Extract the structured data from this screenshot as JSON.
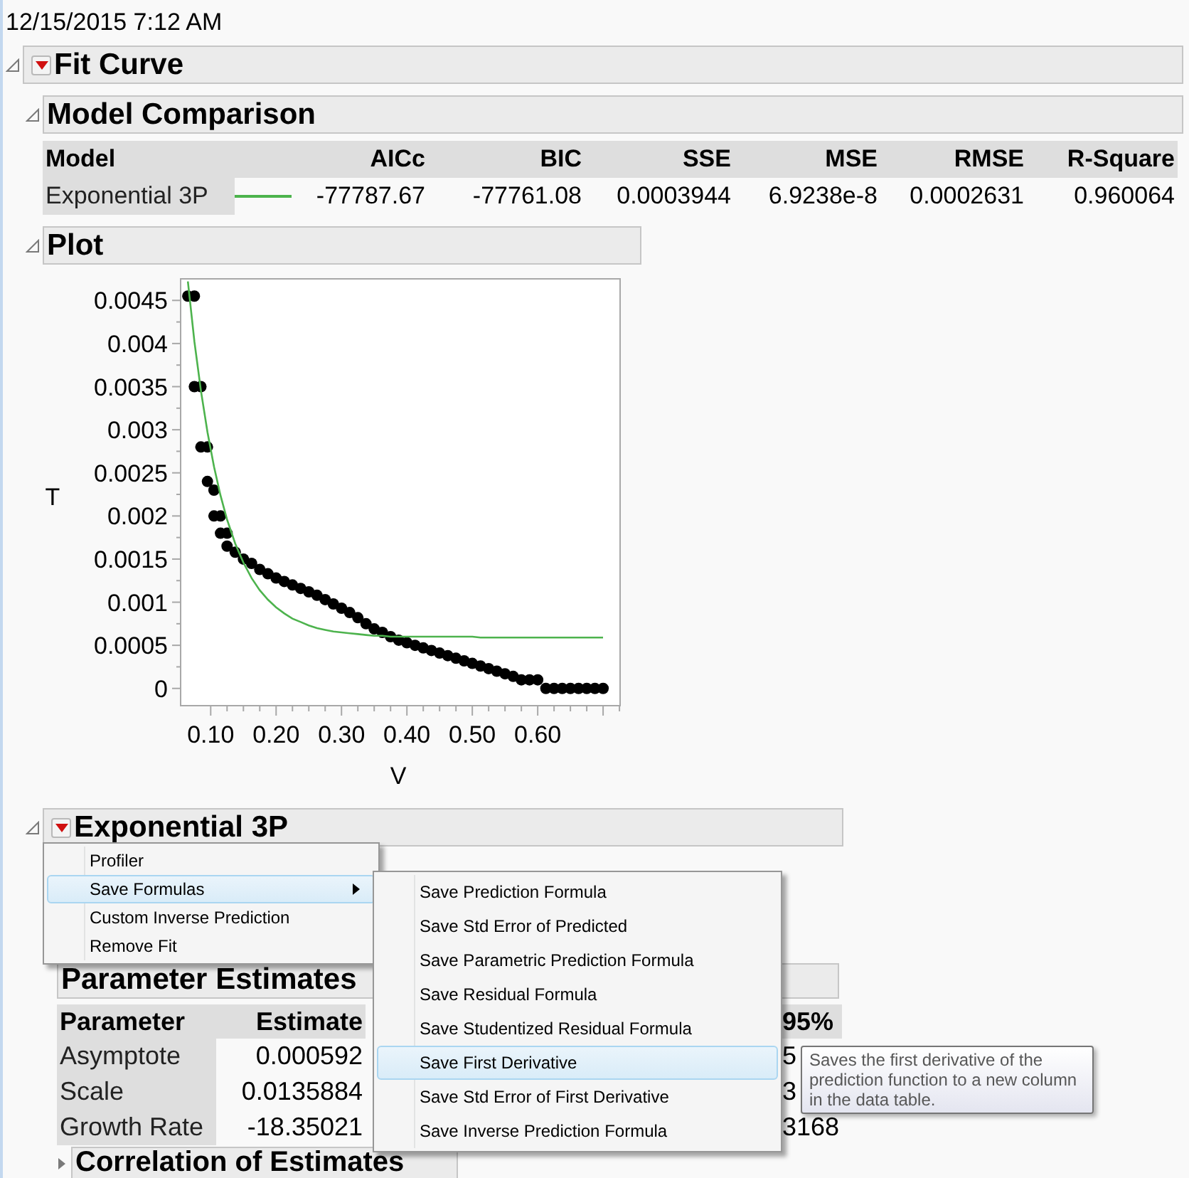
{
  "timestamp": "12/15/2015 7:12 AM",
  "fit_curve": {
    "title": "Fit Curve",
    "expanded": true
  },
  "model_comparison": {
    "title": "Model Comparison",
    "expanded": true,
    "columns": [
      "Model",
      "AICc",
      "BIC",
      "SSE",
      "MSE",
      "RMSE",
      "R-Square"
    ],
    "rows": [
      {
        "model": "Exponential 3P",
        "color": "#4db34d",
        "values": [
          "-77787.67",
          "-77761.08",
          "0.0003944",
          "6.9238e-8",
          "0.0002631",
          "0.960064"
        ]
      }
    ]
  },
  "plot": {
    "title": "Plot",
    "expanded": true,
    "chart_data": {
      "type": "scatter",
      "xlabel": "V",
      "ylabel": "T",
      "x": [
        0.065,
        0.075,
        0.075,
        0.085,
        0.085,
        0.095,
        0.095,
        0.105,
        0.105,
        0.115,
        0.115,
        0.125,
        0.125,
        0.1375,
        0.15,
        0.1625,
        0.175,
        0.1875,
        0.2,
        0.2125,
        0.225,
        0.2375,
        0.25,
        0.2625,
        0.275,
        0.2875,
        0.3,
        0.3125,
        0.325,
        0.3375,
        0.35,
        0.3625,
        0.375,
        0.3875,
        0.4,
        0.4125,
        0.425,
        0.4375,
        0.45,
        0.4625,
        0.475,
        0.4875,
        0.5,
        0.5125,
        0.525,
        0.5375,
        0.55,
        0.5625,
        0.575,
        0.5875,
        0.6,
        0.6125,
        0.625,
        0.6375,
        0.65,
        0.6625,
        0.675,
        0.6875,
        0.7
      ],
      "series": [
        {
          "color": "#000000",
          "values": [
            0.00455,
            0.00455,
            0.0035,
            0.0035,
            0.0028,
            0.0028,
            0.0024,
            0.0023,
            0.002,
            0.002,
            0.0018,
            0.0018,
            0.00165,
            0.00158,
            0.0015,
            0.00145,
            0.00138,
            0.00133,
            0.00128,
            0.00124,
            0.0012,
            0.00116,
            0.00112,
            0.00108,
            0.00103,
            0.00098,
            0.00093,
            0.00088,
            0.00082,
            0.00075,
            0.00069,
            0.00065,
            0.0006,
            0.00056,
            0.00053,
            0.0005,
            0.00047,
            0.00044,
            0.00041,
            0.00038,
            0.00035,
            0.00032,
            0.00029,
            0.00026,
            0.00023,
            0.0002,
            0.00017,
            0.00014,
            0.0001,
            0.0001,
            0.0001,
            0,
            0,
            0,
            0,
            0,
            0,
            0,
            0
          ]
        },
        {
          "color": "#4db34d",
          "type": "line",
          "values": [
            0.00472,
            0.00402,
            0.00402,
            0.00345,
            0.00345,
            0.00297,
            0.00297,
            0.00257,
            0.00257,
            0.00224,
            0.00224,
            0.00196,
            0.00196,
            0.00168,
            0.00146,
            0.00128,
            0.00114,
            0.00103,
            0.00094,
            0.00087,
            0.00081,
            0.00077,
            0.00073,
            0.0007,
            0.00068,
            0.00066,
            0.00065,
            0.00064,
            0.00063,
            0.00062,
            0.00061,
            0.00061,
            0.0006,
            0.0006,
            0.0006,
            0.0006,
            0.0006,
            0.0006,
            0.0006,
            0.0006,
            0.0006,
            0.0006,
            0.0006,
            0.00059,
            0.00059,
            0.00059,
            0.00059,
            0.00059,
            0.00059,
            0.00059,
            0.00059,
            0.00059,
            0.00059,
            0.00059,
            0.00059,
            0.00059,
            0.00059,
            0.00059,
            0.00059
          ]
        }
      ],
      "xlim": [
        0.054,
        0.726
      ],
      "ylim": [
        -0.0002,
        0.00475
      ],
      "xticks": [
        {
          "value": 0.1,
          "label": "0.10"
        },
        {
          "value": 0.2,
          "label": "0.20"
        },
        {
          "value": 0.3,
          "label": "0.30"
        },
        {
          "value": 0.4,
          "label": "0.40"
        },
        {
          "value": 0.5,
          "label": "0.50"
        },
        {
          "value": 0.6,
          "label": "0.60"
        }
      ],
      "yticks": [
        {
          "value": 0,
          "label": "0"
        },
        {
          "value": 0.0005,
          "label": "0.0005"
        },
        {
          "value": 0.001,
          "label": "0.001"
        },
        {
          "value": 0.0015,
          "label": "0.0015"
        },
        {
          "value": 0.002,
          "label": "0.002"
        },
        {
          "value": 0.0025,
          "label": "0.0025"
        },
        {
          "value": 0.003,
          "label": "0.003"
        },
        {
          "value": 0.0035,
          "label": "0.0035"
        },
        {
          "value": 0.004,
          "label": "0.004"
        },
        {
          "value": 0.0045,
          "label": "0.0045"
        }
      ]
    }
  },
  "exponential_3p": {
    "title": "Exponential 3P",
    "expanded": true
  },
  "parameter_estimates": {
    "title": "Parameter Estimates",
    "columns": [
      "Parameter",
      "Estimate",
      "95%"
    ],
    "rows": [
      [
        "Asymptote",
        "0.000592",
        "5"
      ],
      [
        "Scale",
        "0.0135884",
        "3"
      ],
      [
        "Growth Rate",
        "-18.35021",
        "3168"
      ]
    ]
  },
  "correlation_of_estimates": {
    "title": "Correlation of Estimates",
    "expanded": false
  },
  "context_menu": [
    {
      "label": "Profiler",
      "selected": false,
      "has_submenu": false
    },
    {
      "label": "Save Formulas",
      "selected": true,
      "has_submenu": true
    },
    {
      "label": "Custom Inverse Prediction",
      "selected": false,
      "has_submenu": false
    },
    {
      "label": "Remove Fit",
      "selected": false,
      "has_submenu": false
    }
  ],
  "submenu": [
    {
      "label": "Save Prediction Formula",
      "selected": false
    },
    {
      "label": "Save Std Error of Predicted",
      "selected": false
    },
    {
      "label": "Save Parametric Prediction Formula",
      "selected": false
    },
    {
      "label": "Save Residual Formula",
      "selected": false
    },
    {
      "label": "Save Studentized Residual Formula",
      "selected": false
    },
    {
      "label": "Save First Derivative",
      "selected": true
    },
    {
      "label": "Save Std Error of First Derivative",
      "selected": false
    },
    {
      "label": "Save Inverse Prediction Formula",
      "selected": false
    }
  ],
  "tooltip": "Saves the first derivative of the prediction function to a new column in the data table."
}
